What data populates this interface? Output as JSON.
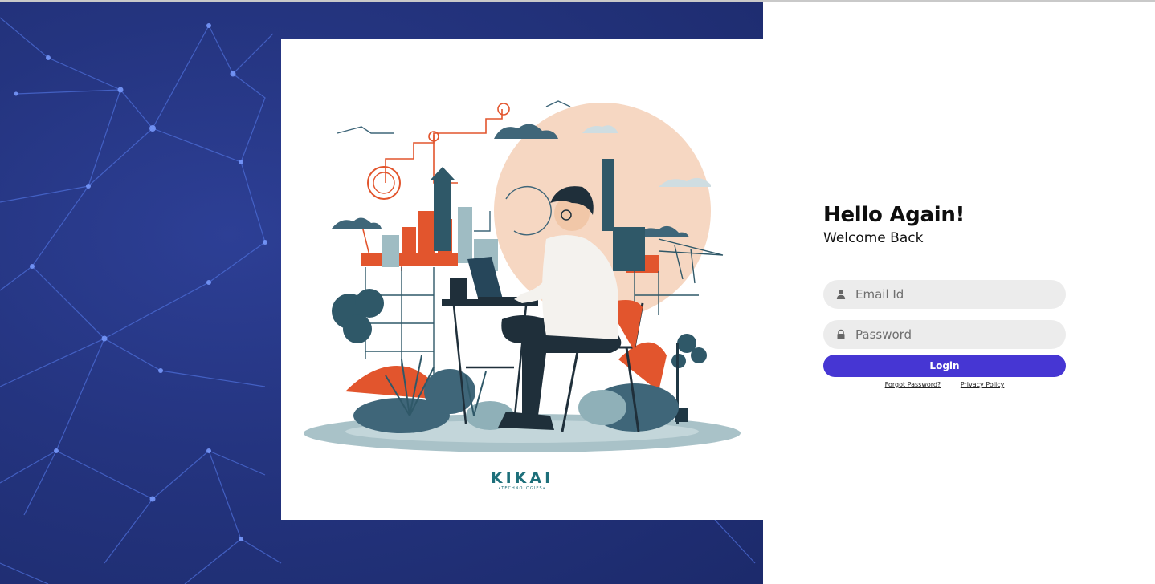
{
  "illustration": {
    "logo_text": "KIKAI",
    "logo_subtext": "•TECHNOLOGIES•"
  },
  "login": {
    "title": "Hello Again!",
    "subtitle": "Welcome Back",
    "email_placeholder": "Email Id",
    "password_placeholder": "Password",
    "login_label": "Login",
    "forgot_password_label": "Forgot Password?",
    "privacy_policy_label": "Privacy Policy"
  },
  "icons": {
    "email_field": "user-icon",
    "password_field": "lock-icon"
  },
  "colors": {
    "background_left": "#24347f",
    "login_button": "#4636d3",
    "input_background": "#ececec",
    "logo": "#1d6f7a",
    "illustration_accent": "#e2552d"
  }
}
